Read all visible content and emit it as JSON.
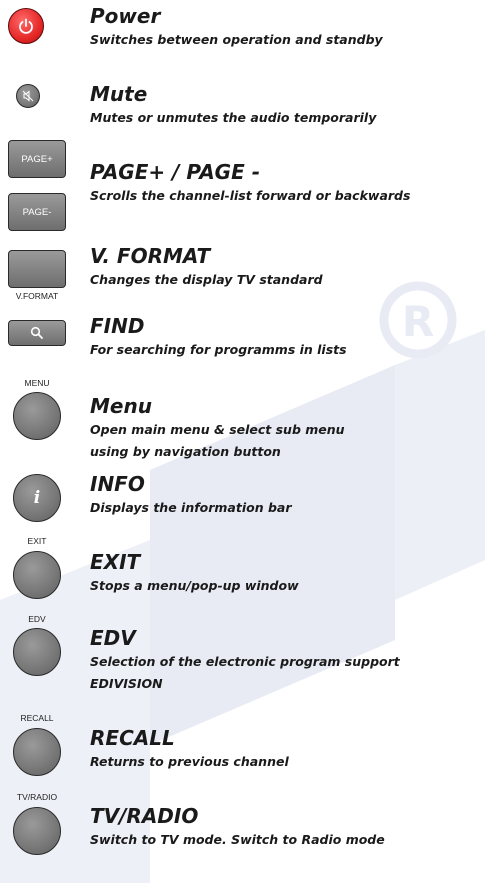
{
  "buttons": [
    {
      "title": "Power",
      "desc": "Switches between operation and standby",
      "icon": "power-icon"
    },
    {
      "title": "Mute",
      "desc": "Mutes or unmutes the audio temporarily",
      "icon": "mute-icon"
    },
    {
      "title": "PAGE+ / PAGE -",
      "desc": "Scrolls the channel-list forward or backwards",
      "label_plus": "PAGE+",
      "label_minus": "PAGE-"
    },
    {
      "title": "V. FORMAT",
      "desc": "Changes the display TV standard",
      "label": "V.FORMAT"
    },
    {
      "title": "FIND",
      "desc": "For searching for programms in lists",
      "icon": "search-icon"
    },
    {
      "title": "Menu",
      "desc_line1": "Open main menu & select sub menu",
      "desc_line2": "using by navigation button",
      "label": "MENU"
    },
    {
      "title": "INFO",
      "desc": "Displays the information bar",
      "icon": "info-icon",
      "icon_glyph": "i"
    },
    {
      "title": "EXIT",
      "desc": "Stops a menu/pop-up window",
      "label": "EXIT"
    },
    {
      "title": "EDV",
      "desc_line1": "Selection of the electronic program support",
      "desc_line2": "EDIVISION",
      "label": "EDV"
    },
    {
      "title": "RECALL",
      "desc": "Returns to previous channel",
      "label": "RECALL"
    },
    {
      "title": "TV/RADIO",
      "desc": "Switch to TV mode. Switch to Radio mode",
      "label": "TV/RADIO"
    }
  ],
  "colors": {
    "power_red": "#e62828",
    "button_gray": "#7a7a7a",
    "watermark": "#e6e9f3",
    "text": "#1a1a1a"
  }
}
